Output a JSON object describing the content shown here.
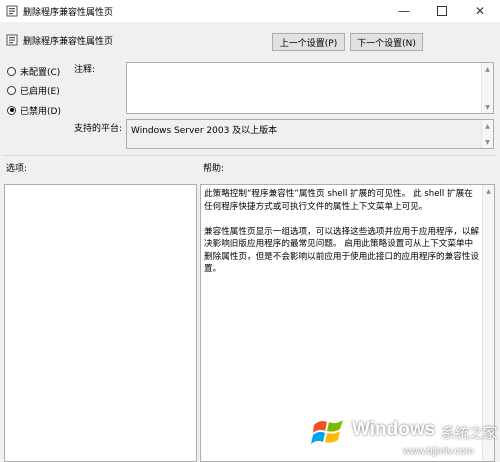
{
  "window": {
    "title": "删除程序兼容性属性页",
    "minimize_icon": "minimize-icon",
    "maximize_icon": "maximize-icon",
    "close_icon": "close-icon"
  },
  "header": {
    "policy_title": "删除程序兼容性属性页",
    "prev_button": "上一个设置(P)",
    "next_button": "下一个设置(N)"
  },
  "state": {
    "options": [
      {
        "label": "未配置(C)",
        "checked": false
      },
      {
        "label": "已启用(E)",
        "checked": false
      },
      {
        "label": "已禁用(D)",
        "checked": true
      }
    ]
  },
  "comment": {
    "label": "注释:",
    "value": ""
  },
  "platform": {
    "label": "支持的平台:",
    "value": "Windows Server 2003 及以上版本"
  },
  "sections": {
    "options_label": "选项:",
    "help_label": "帮助:"
  },
  "help": {
    "text": "此策略控制“程序兼容性”属性页 shell 扩展的可见性。 此 shell 扩展在任何程序快捷方式或可执行文件的属性上下文菜单上可见。\n\n兼容性属性页显示一组选项，可以选择这些选项并应用于应用程序，以解决影响旧版应用程序的最常见问题。 启用此策略设置可从上下文菜单中删除属性页，但是不会影响以前应用于使用此接口的应用程序的兼容性设置。"
  },
  "watermark": {
    "brand": "Windows",
    "site_cn": "系统之家",
    "site_url": "www.bjjmlv.com",
    "colors": [
      "#f25022",
      "#7fba00",
      "#00a4ef",
      "#ffb900"
    ]
  }
}
